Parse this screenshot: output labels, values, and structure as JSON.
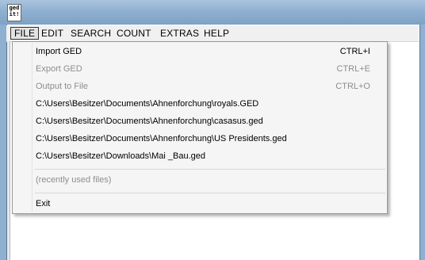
{
  "window": {
    "icon": {
      "text_line1": "ged",
      "text_line2": "it!"
    }
  },
  "menubar": {
    "items": [
      {
        "label": "FILE"
      },
      {
        "label": "EDIT"
      },
      {
        "label": "SEARCH"
      },
      {
        "label": "COUNT"
      },
      {
        "label": "EXTRAS"
      },
      {
        "label": "HELP"
      }
    ]
  },
  "file_menu": {
    "import": {
      "label": "Import GED",
      "shortcut": "CTRL+I",
      "enabled": true
    },
    "export": {
      "label": "Export GED",
      "shortcut": "CTRL+E",
      "enabled": false
    },
    "output": {
      "label": "Output to File",
      "shortcut": "CTRL+O",
      "enabled": false
    },
    "recent_files": [
      "C:\\Users\\Besitzer\\Documents\\Ahnenforchung\\royals.GED",
      "C:\\Users\\Besitzer\\Documents\\Ahnenforchung\\casasus.ged",
      "C:\\Users\\Besitzer\\Documents\\Ahnenforchung\\US Presidents.ged",
      "C:\\Users\\Besitzer\\Downloads\\Mai _Bau.ged"
    ],
    "recent_caption": "(recently used files)",
    "exit": {
      "label": "Exit"
    }
  },
  "colors": {
    "titlebar": "#8fb0d1",
    "menu_background": "#f5f5f5",
    "disabled_text": "#8d8d8d"
  }
}
